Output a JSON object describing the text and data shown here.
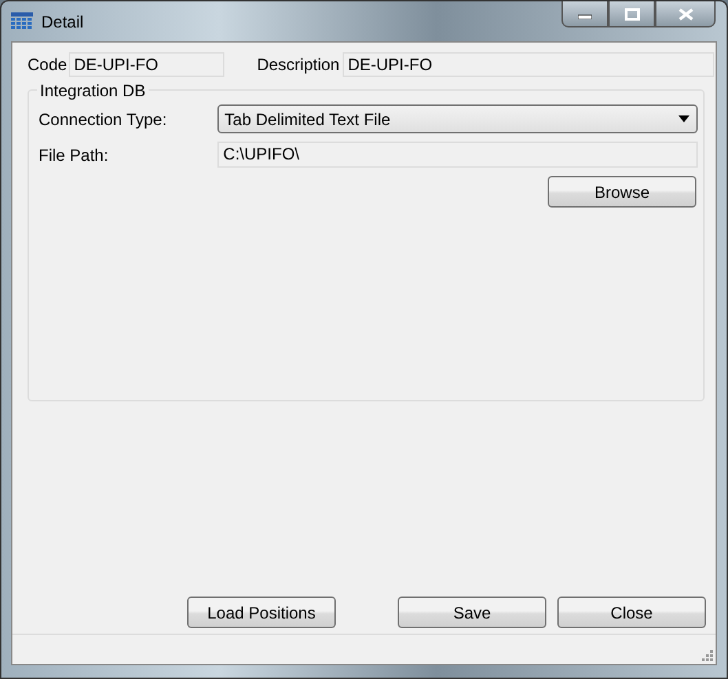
{
  "window": {
    "title": "Detail"
  },
  "header": {
    "code": {
      "label": "Code",
      "value": "DE-UPI-FO"
    },
    "description": {
      "label": "Description",
      "value": "DE-UPI-FO"
    }
  },
  "integration_db": {
    "legend": "Integration DB",
    "connection_type": {
      "label": "Connection Type:",
      "value": "Tab Delimited Text File"
    },
    "file_path": {
      "label": "File Path:",
      "value": "C:\\UPIFO\\"
    },
    "browse_button": "Browse"
  },
  "buttons": [
    {
      "label": "Load Positions"
    },
    {
      "label": "Save"
    },
    {
      "label": "Close"
    }
  ]
}
